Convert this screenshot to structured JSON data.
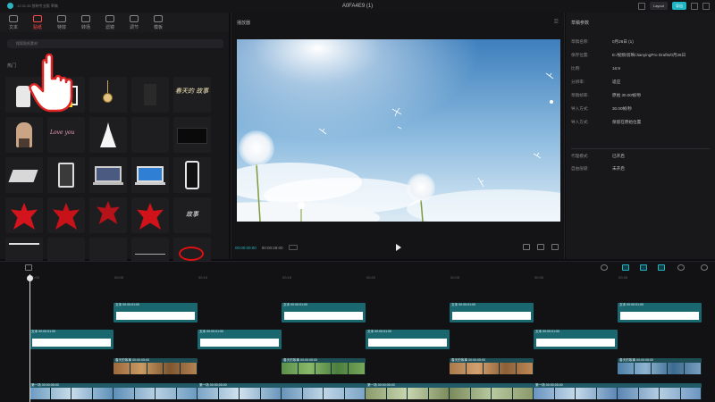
{
  "app": {
    "title": "A0FA4E9 (1)",
    "subtitle": "12:31:35 剪映专业版 草稿",
    "buttons": [
      "Layout",
      "导出"
    ]
  },
  "media_panel": {
    "tabs": [
      {
        "label": "文本",
        "icon": "text-icon"
      },
      {
        "label": "贴纸",
        "icon": "sticker-icon",
        "active": true
      },
      {
        "label": "特效",
        "icon": "effect-icon"
      },
      {
        "label": "转场",
        "icon": "transition-icon"
      },
      {
        "label": "滤镜",
        "icon": "filter-icon"
      },
      {
        "label": "调节",
        "icon": "adjust-icon"
      },
      {
        "label": "模板",
        "icon": "template-icon"
      }
    ],
    "search_placeholder": "搜索贴纸素材",
    "section_label": "热门",
    "sticker_texts": [
      "春天的 故事",
      "Love you",
      "故事"
    ]
  },
  "player": {
    "title": "播放器",
    "menu_icon": "more-icon",
    "timecode_current": "00:00:00:00",
    "timecode_total": "00:00:28:00",
    "tools": [
      "fullscreen-icon",
      "ratio-icon",
      "expand-icon"
    ]
  },
  "properties": {
    "title": "草稿参数",
    "rows": [
      {
        "k": "草稿名称:",
        "v": "0月26日 (1)"
      },
      {
        "k": "保存位置:",
        "v": "E:/视频/剪映/JianyingPro Drafts/0月26日"
      },
      {
        "k": "比例:",
        "v": "16:9"
      },
      {
        "k": "分辨率:",
        "v": "适应"
      },
      {
        "k": "草稿帧率:",
        "v": "原始 30.00帧/秒"
      },
      {
        "k": "导入方式:",
        "v": "30.00帧/秒"
      },
      {
        "k": "导入方式:",
        "v": "保留在原始位置"
      },
      {
        "k": "代理模式:",
        "v": "已开启"
      },
      {
        "k": "自由层级:",
        "v": "未开启"
      }
    ]
  },
  "timeline": {
    "ticks": [
      "00:00",
      "00:05",
      "00:10",
      "00:15",
      "00:20",
      "00:25",
      "00:30",
      "00:35"
    ],
    "text_label": "文本",
    "text_label_full": "文本  00:00:01:00",
    "video_label": "春天的故事 00:00:05:00",
    "main_label": "第一场 00:00:05:00",
    "clip_names": [
      "文本",
      "文本",
      "文本",
      "文本",
      "文本",
      "文本",
      "文本",
      "文本",
      "文本"
    ]
  },
  "colors": {
    "accent": "#1fb4c4",
    "active_tab": "#ff4a4a",
    "text_clip": "#1a6770",
    "video_clip": "#1d4e56"
  }
}
